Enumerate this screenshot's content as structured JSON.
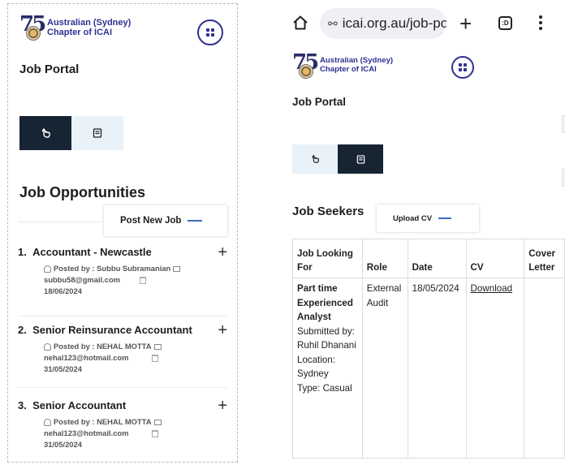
{
  "left": {
    "logo": {
      "number": "75",
      "line1": "Australian (Sydney)",
      "line2": "Chapter of ICAI"
    },
    "portal_title": "Job Portal",
    "section_title": "Job Opportunities",
    "post_button": "Post New Job",
    "jobs": [
      {
        "num": "1.",
        "title": "Accountant - Newcastle",
        "posted_by": "Posted by : Subbu Subramanian",
        "email": "subbu58@gmail.com",
        "date": "18/06/2024"
      },
      {
        "num": "2.",
        "title": "Senior Reinsurance Accountant",
        "posted_by": "Posted by : NEHAL MOTTA",
        "email": "nehal123@hotmail.com",
        "date": "31/05/2024"
      },
      {
        "num": "3.",
        "title": "Senior Accountant",
        "posted_by": "Posted by : NEHAL MOTTA",
        "email": "nehal123@hotmail.com",
        "date": "31/05/2024"
      }
    ],
    "expand_symbol": "+"
  },
  "browser": {
    "url": "icai.org.au/job-po",
    "tune_glyph": "⚯",
    "new_tab": "+",
    "tab_count": ":D"
  },
  "right": {
    "logo": {
      "number": "75",
      "line1": "Australian (Sydney)",
      "line2": "Chapter of ICAI"
    },
    "portal_title": "Job Portal",
    "section_title": "Job Seekers",
    "upload_button": "Upload CV",
    "table": {
      "headers": [
        "Job Looking For",
        "Role",
        "Date",
        "CV",
        "Cover Letter"
      ],
      "row": {
        "job_title": "Part time Experienced Analyst",
        "submitted": "Submitted by: Ruhil Dhanani",
        "location": "Location: Sydney",
        "type": "Type: Casual",
        "role": "External Audit",
        "date": "18/05/2024",
        "cv": "Download",
        "cover": ""
      }
    }
  },
  "colors": {
    "brand": "#2f3192",
    "toggle_dark": "#172433",
    "toggle_light": "#e8f2f8",
    "accent_line": "#3c6bc4"
  },
  "icons": [
    "home-icon",
    "grid-menu-icon",
    "hand-pointer-icon",
    "book-icon",
    "user-icon",
    "mail-icon",
    "calendar-icon",
    "plus-icon",
    "kebab-menu-icon",
    "tune-icon"
  ]
}
